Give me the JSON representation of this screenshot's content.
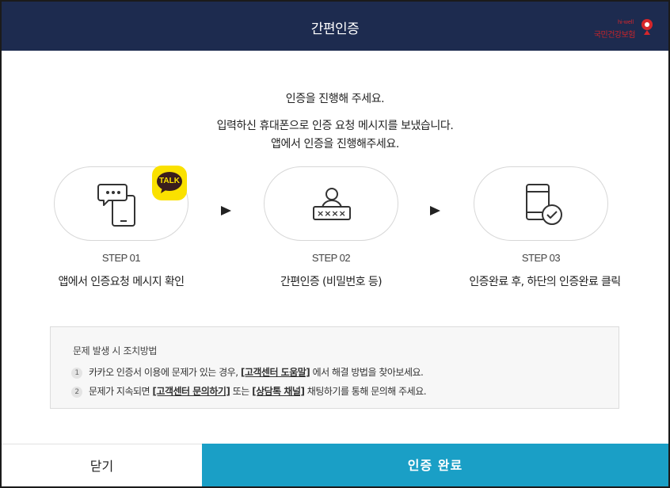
{
  "header": {
    "title": "간편인증",
    "logo_small": "hi-well",
    "logo_text": "국민건강보험",
    "logo_color": "#d6262b",
    "bg_color": "#1d2b4f"
  },
  "intro": {
    "line1": "인증을 진행해 주세요.",
    "line2": "입력하신 휴대폰으로 인증 요청 메시지를 보냈습니다.",
    "line3": "앱에서 인증을 진행해주세요."
  },
  "steps": [
    {
      "number": "STEP 01",
      "desc": "앱에서 인증요청 메시지 확인",
      "icon": "phone-message-icon"
    },
    {
      "number": "STEP 02",
      "desc": "간편인증 (비밀번호 등)",
      "icon": "user-password-icon"
    },
    {
      "number": "STEP 03",
      "desc": "인증완료 후, 하단의 인증완료 클릭",
      "icon": "phone-check-icon"
    }
  ],
  "talk_badge": {
    "label": "TALK",
    "color": "#fae100"
  },
  "notice": {
    "title": "문제 발생 시 조치방법",
    "items": [
      {
        "num": "1",
        "prefix": "카카오 인증서 이용에 문제가 있는 경우, ",
        "link1": "[고객센터 도움말]",
        "suffix": " 에서 해결 방법을 찾아보세요."
      },
      {
        "num": "2",
        "prefix": "문제가 지속되면 ",
        "link1": "[고객센터 문의하기]",
        "middle": " 또는 ",
        "link2": "[상담톡 채널]",
        "suffix": " 채팅하기를 통해 문의해 주세요."
      }
    ]
  },
  "buttons": {
    "close": "닫기",
    "complete": "인증 완료",
    "complete_color": "#1a9fc6"
  }
}
